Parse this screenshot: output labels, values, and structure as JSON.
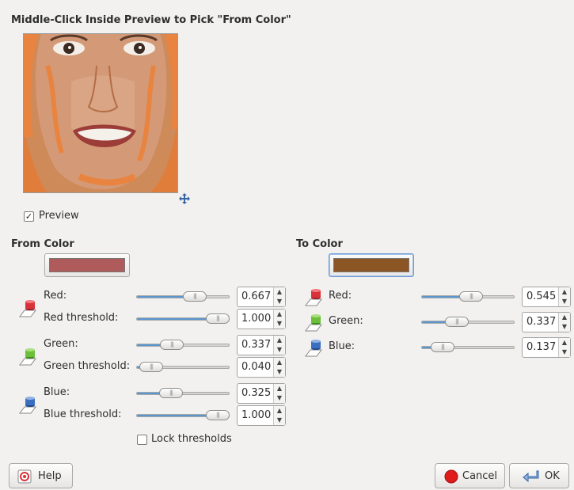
{
  "dialog": {
    "title": "Middle-Click Inside Preview to Pick \"From Color\"",
    "preview_checkbox": {
      "label": "Preview",
      "checked": true
    }
  },
  "from_color": {
    "heading": "From Color",
    "swatch_color": "#b05b5b",
    "channels": [
      {
        "label": "Red:",
        "value": "0.667",
        "fraction": 0.667
      },
      {
        "label": "Red threshold:",
        "value": "1.000",
        "fraction": 1.0
      },
      {
        "label": "Green:",
        "value": "0.337",
        "fraction": 0.337
      },
      {
        "label": "Green threshold:",
        "value": "0.040",
        "fraction": 0.04
      },
      {
        "label": "Blue:",
        "value": "0.325",
        "fraction": 0.325
      },
      {
        "label": "Blue threshold:",
        "value": "1.000",
        "fraction": 1.0
      }
    ],
    "lock_thresholds": {
      "label": "Lock thresholds",
      "checked": false
    }
  },
  "to_color": {
    "heading": "To Color",
    "swatch_color": "#8b5623",
    "channels": [
      {
        "label": "Red:",
        "value": "0.545",
        "fraction": 0.545
      },
      {
        "label": "Green:",
        "value": "0.337",
        "fraction": 0.337
      },
      {
        "label": "Blue:",
        "value": "0.137",
        "fraction": 0.137
      }
    ]
  },
  "buttons": {
    "help": "Help",
    "cancel": "Cancel",
    "ok": "OK"
  },
  "colors": {
    "accent": "#5c96cf",
    "red_icon": "#d9323a",
    "green_icon": "#6bbf3a",
    "blue_icon": "#3a6fbf",
    "cancel_icon": "#e01b1b"
  }
}
